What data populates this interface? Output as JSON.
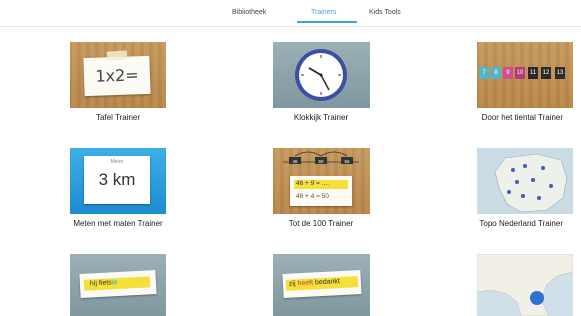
{
  "nav": {
    "tabs": [
      {
        "label": "Bibliotheek"
      },
      {
        "label": "Trainers"
      },
      {
        "label": "Kids Tools"
      }
    ]
  },
  "trainers": [
    {
      "label": "Tafel Trainer",
      "thumb_text": "1x2="
    },
    {
      "label": "Klokkijk Trainer"
    },
    {
      "label": "Door het tiental Trainer",
      "numbers": [
        "7",
        "8",
        "9",
        "10",
        "11",
        "12",
        "13"
      ]
    },
    {
      "label": "Meten met maten Trainer",
      "thumb_caption": "Meter",
      "thumb_text": "3 km"
    },
    {
      "label": "Tot de 100 Trainer",
      "line1": "46 + 9 = ....",
      "line2": "46 + 4 = 50",
      "bubbles": [
        "46",
        "50",
        "55"
      ]
    },
    {
      "label": "Topo Nederland Trainer"
    },
    {
      "label": "",
      "sentence_pre": "hij fiets",
      "sentence_suffix": "te"
    },
    {
      "label": "",
      "sentence_pre": "zij ",
      "sentence_mid": "heeft",
      "sentence_post": " bedankt"
    },
    {
      "label": ""
    }
  ],
  "colors": {
    "accent": "#3aa5dc",
    "highlight": "#f5e03a",
    "number_tiles": [
      "#4fb7c9",
      "#4fb7c9",
      "#cf4e8f",
      "#b13a7e",
      "#2b2b2b",
      "#2b2b2b",
      "#2b2b2b"
    ]
  }
}
